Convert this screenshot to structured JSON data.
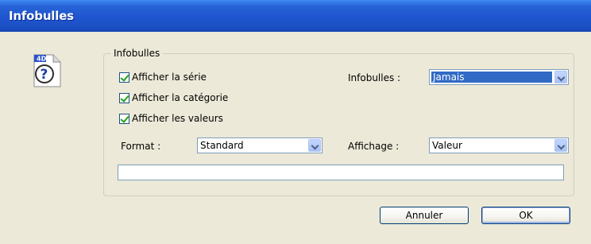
{
  "window": {
    "title": "Infobulles"
  },
  "group": {
    "label": "Infobulles"
  },
  "checkboxes": [
    {
      "label": "Afficher la série",
      "checked": true
    },
    {
      "label": "Afficher la catégorie",
      "checked": true
    },
    {
      "label": "Afficher les valeurs",
      "checked": true
    }
  ],
  "infobulles": {
    "label": "Infobulles :",
    "value": "Jamais"
  },
  "format": {
    "label": "Format :",
    "value": "Standard"
  },
  "affichage": {
    "label": "Affichage :",
    "value": "Valeur"
  },
  "custom_format": {
    "value": ""
  },
  "buttons": {
    "cancel": "Annuler",
    "ok": "OK"
  },
  "icon": {
    "name": "4d-help-icon",
    "badge": "4D",
    "glyph": "?"
  }
}
